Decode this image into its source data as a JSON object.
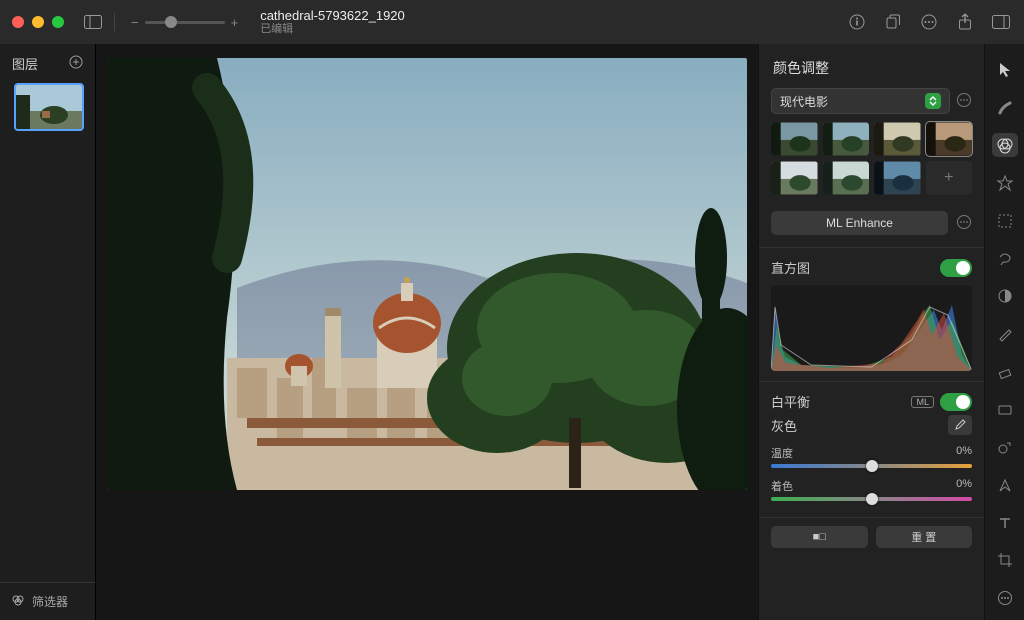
{
  "title": {
    "filename": "cathedral-5793622_1920",
    "status": "已编辑"
  },
  "zoom": {
    "minus": "−",
    "plus": "+",
    "pos": 30
  },
  "layers": {
    "heading": "图层"
  },
  "filters_label": "筛选器",
  "panel": {
    "title": "颜色调整",
    "preset_selected": "现代电影",
    "ml_enhance": "ML Enhance",
    "histogram_label": "直方图",
    "white_balance_label": "白平衡",
    "ml_chip": "ML",
    "gray_label": "灰色",
    "temperature": {
      "label": "温度",
      "value": "0%"
    },
    "tint": {
      "label": "着色",
      "value": "0%"
    },
    "reset": "重 置",
    "split_icon_a": "■",
    "split_icon_b": "□"
  },
  "traffic": {
    "close": "#ff5f57",
    "min": "#febc2e",
    "max": "#28c840"
  }
}
